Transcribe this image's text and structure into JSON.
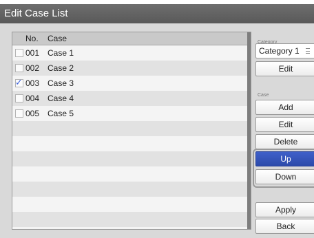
{
  "window": {
    "title": "Edit Case List"
  },
  "list": {
    "columns": {
      "no": "No.",
      "case": "Case"
    },
    "rows": [
      {
        "no": "001",
        "case": "Case 1",
        "checked": false
      },
      {
        "no": "002",
        "case": "Case 2",
        "checked": false
      },
      {
        "no": "003",
        "case": "Case 3",
        "checked": true
      },
      {
        "no": "004",
        "case": "Case 4",
        "checked": false
      },
      {
        "no": "005",
        "case": "Case 5",
        "checked": false
      },
      {
        "no": "",
        "case": "",
        "checked": null
      },
      {
        "no": "",
        "case": "",
        "checked": null
      },
      {
        "no": "",
        "case": "",
        "checked": null
      },
      {
        "no": "",
        "case": "",
        "checked": null
      },
      {
        "no": "",
        "case": "",
        "checked": null
      },
      {
        "no": "",
        "case": "",
        "checked": null
      },
      {
        "no": "",
        "case": "",
        "checked": null
      }
    ],
    "check_mark": "✓"
  },
  "category": {
    "label": "Category",
    "selected": "Category 1",
    "edit_label": "Edit"
  },
  "case_actions": {
    "label": "Case",
    "add_label": "Add",
    "edit_label": "Edit",
    "delete_label": "Delete",
    "up_label": "Up",
    "down_label": "Down",
    "selected_button": "Up"
  },
  "footer": {
    "apply_label": "Apply",
    "back_label": "Back"
  },
  "colors": {
    "title_bar": "#5f5f5f",
    "panel_bg": "#d9d9d9",
    "selected_button": "#3452b8",
    "check_mark": "#3b5fd9"
  }
}
